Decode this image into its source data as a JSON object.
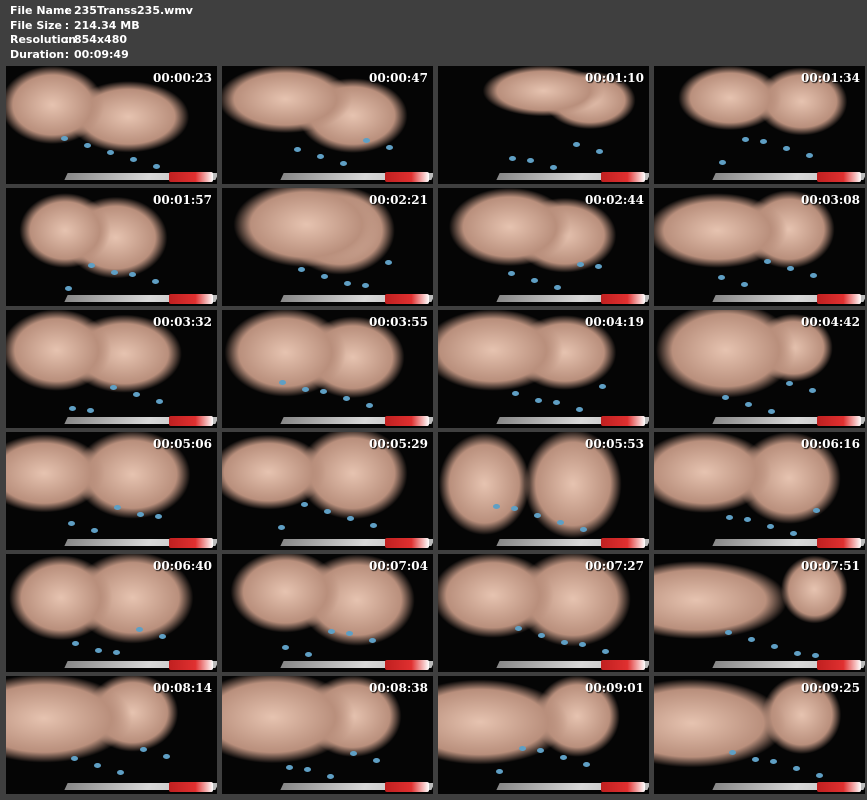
{
  "info": {
    "rows": [
      {
        "key": "File Name",
        "value": "235Transs235.wmv"
      },
      {
        "key": "File Size",
        "value": "214.34 MB"
      },
      {
        "key": "Resolution",
        "value": "854x480"
      },
      {
        "key": "Duration",
        "value": "00:09:49"
      }
    ],
    "separator": ":"
  },
  "thumbnails": [
    "00:00:23",
    "00:00:47",
    "00:01:10",
    "00:01:34",
    "00:01:57",
    "00:02:21",
    "00:02:44",
    "00:03:08",
    "00:03:32",
    "00:03:55",
    "00:04:19",
    "00:04:42",
    "00:05:06",
    "00:05:29",
    "00:05:53",
    "00:06:16",
    "00:06:40",
    "00:07:04",
    "00:07:27",
    "00:07:51",
    "00:08:14",
    "00:08:38",
    "00:09:01",
    "00:09:25"
  ],
  "colors": {
    "background": "#3f3f3f",
    "thumb_background": "#050505",
    "skin": "#e6c3b0",
    "nail_polish": "#5f9fc4"
  }
}
